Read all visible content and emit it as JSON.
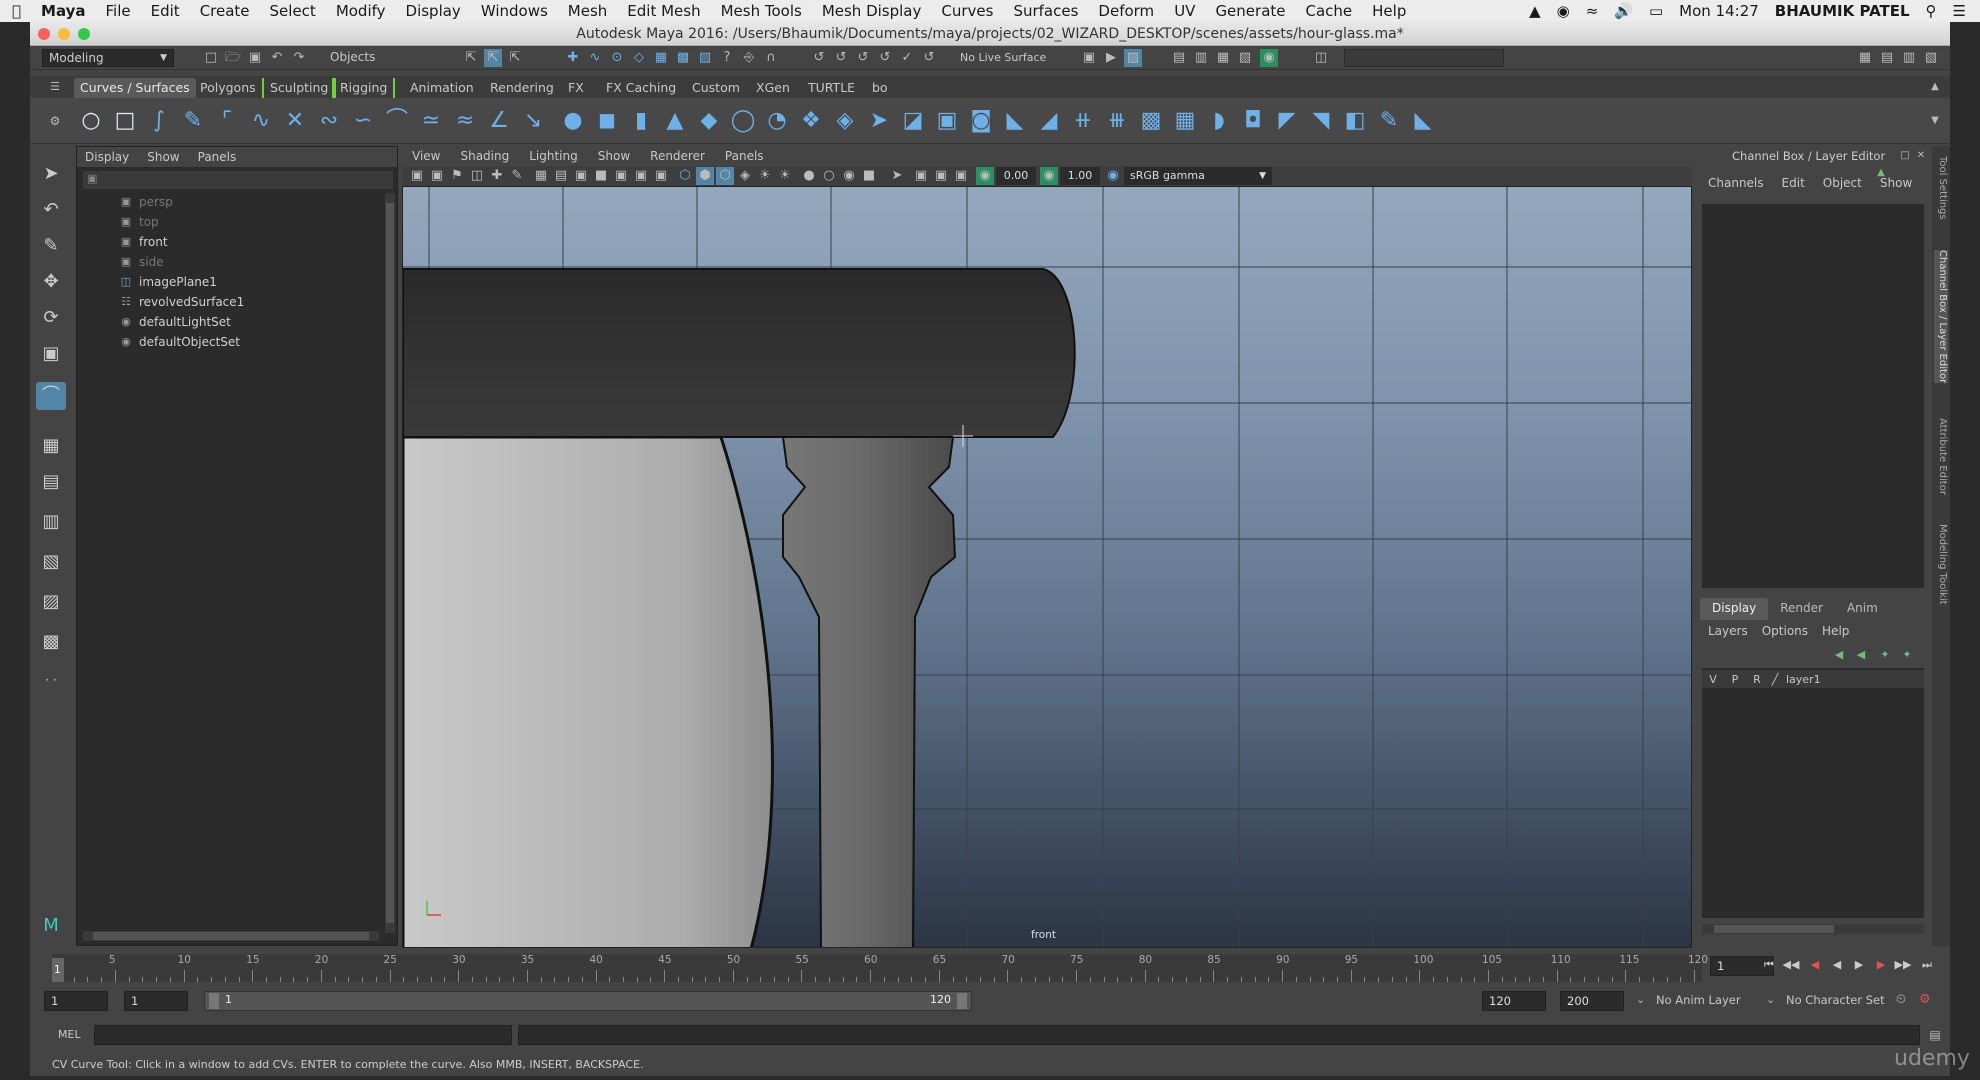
{
  "mac_menubar": {
    "app": "Maya",
    "items": [
      "File",
      "Edit",
      "Create",
      "Select",
      "Modify",
      "Display",
      "Windows",
      "Mesh",
      "Edit Mesh",
      "Mesh Tools",
      "Mesh Display",
      "Curves",
      "Surfaces",
      "Deform",
      "UV",
      "Generate",
      "Cache",
      "Help"
    ],
    "clock": "Mon 14:27",
    "user": "BHAUMIK PATEL"
  },
  "window": {
    "title": "Autodesk Maya 2016: /Users/Bhaumik/Documents/maya/projects/02_WIZARD_DESKTOP/scenes/assets/hour-glass.ma*"
  },
  "status_line": {
    "menu_set": "Modeling",
    "selection_mode": "Objects",
    "live_surface": "No Live Surface"
  },
  "shelf": {
    "tabs": [
      "Curves / Surfaces",
      "Polygons",
      "Sculpting",
      "Rigging",
      "Animation",
      "Rendering",
      "FX",
      "FX Caching",
      "Custom",
      "XGen",
      "TURTLE",
      "bo"
    ],
    "active_tab": "Curves / Surfaces"
  },
  "outliner": {
    "menu": [
      "Display",
      "Show",
      "Panels"
    ],
    "items": [
      {
        "label": "persp",
        "icon": "camera-icon",
        "dim": true
      },
      {
        "label": "top",
        "icon": "camera-icon",
        "dim": true
      },
      {
        "label": "front",
        "icon": "camera-icon",
        "dim": false
      },
      {
        "label": "side",
        "icon": "camera-icon",
        "dim": true
      },
      {
        "label": "imagePlane1",
        "icon": "image-plane-icon",
        "dim": false
      },
      {
        "label": "revolvedSurface1",
        "icon": "nurbs-surface-icon",
        "dim": false
      },
      {
        "label": "defaultLightSet",
        "icon": "set-icon",
        "dim": false
      },
      {
        "label": "defaultObjectSet",
        "icon": "set-icon",
        "dim": false
      }
    ]
  },
  "viewport": {
    "menu": [
      "View",
      "Shading",
      "Lighting",
      "Show",
      "Renderer",
      "Panels"
    ],
    "exposure": "0.00",
    "gamma": "1.00",
    "color_space": "sRGB gamma",
    "camera_label": "front"
  },
  "channel_box": {
    "title": "Channel Box / Layer Editor",
    "menu": [
      "Channels",
      "Edit",
      "Object",
      "Show"
    ],
    "layer_tabs": [
      "Display",
      "Render",
      "Anim"
    ],
    "layer_menu": [
      "Layers",
      "Options",
      "Help"
    ],
    "layer": {
      "v": "V",
      "p": "P",
      "r": "R",
      "name": "layer1"
    }
  },
  "side_tabs": [
    "Tool Settings",
    "Channel Box / Layer Editor",
    "Attribute Editor",
    "Modeling Toolkit"
  ],
  "timeline": {
    "ticks": [
      5,
      10,
      15,
      20,
      25,
      30,
      35,
      40,
      45,
      50,
      55,
      60,
      65,
      70,
      75,
      80,
      85,
      90,
      95,
      100,
      105,
      110,
      115,
      120
    ],
    "current_frame": "1",
    "current_frame_field": "1"
  },
  "range_slider": {
    "start": "1",
    "playback_start": "1",
    "range_start": "1",
    "range_end": "120",
    "playback_end": "120",
    "end": "200",
    "anim_layer": "No Anim Layer",
    "character_set": "No Character Set"
  },
  "command_line": {
    "label": "MEL"
  },
  "help_line": {
    "text": "CV Curve Tool: Click in a window to add CVs. ENTER to complete the curve. Also MMB, INSERT, BACKSPACE."
  },
  "watermark": "udemy"
}
